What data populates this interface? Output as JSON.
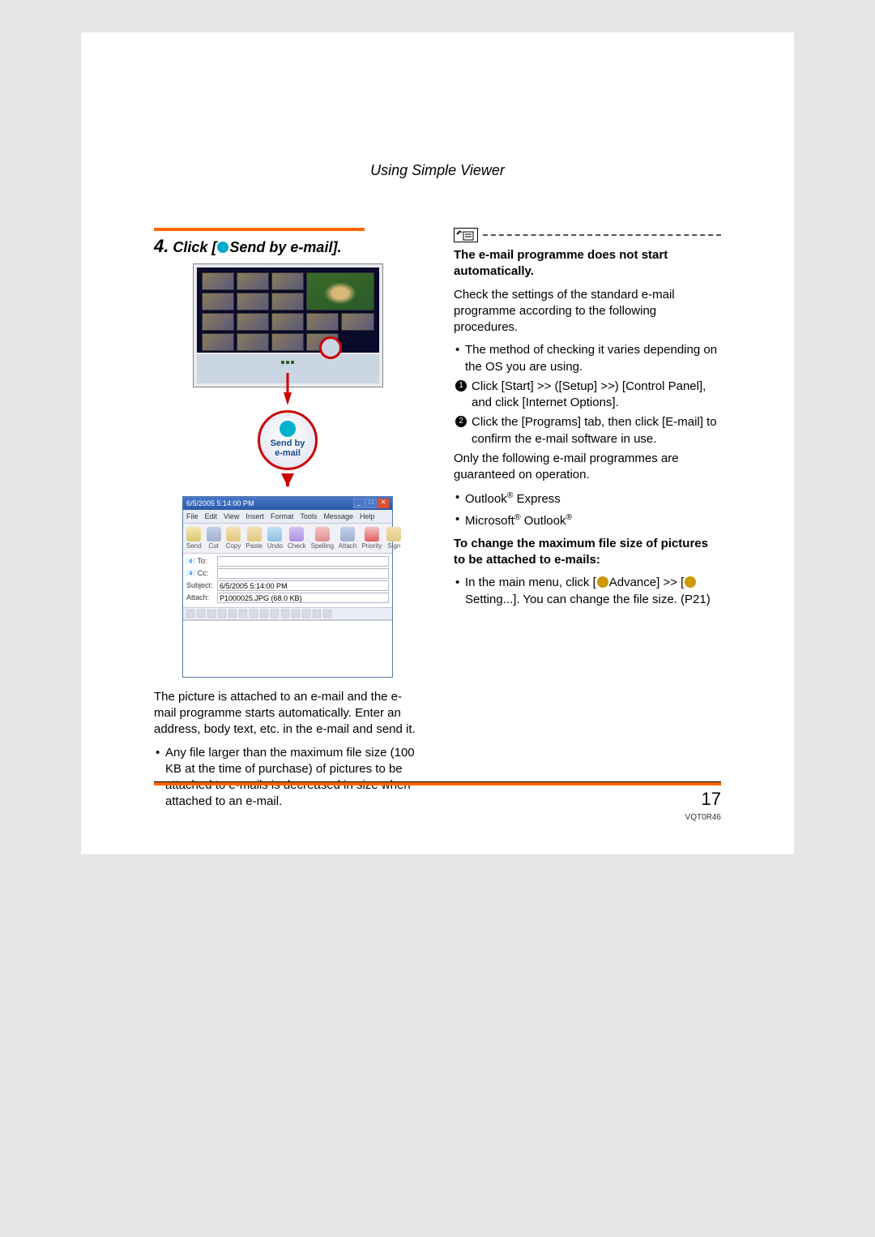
{
  "header": "Using Simple Viewer",
  "left": {
    "step_number": "4.",
    "step_text_prefix": "Click [",
    "step_text_suffix": "Send by e-mail].",
    "big_button": "Send by\ne-mail",
    "email_window": {
      "title": "6/5/2005 5:14:00 PM",
      "menus": [
        "File",
        "Edit",
        "View",
        "Insert",
        "Format",
        "Tools",
        "Message",
        "Help"
      ],
      "toolbar": [
        "Send",
        "Cut",
        "Copy",
        "Paste",
        "Undo",
        "Check",
        "Spelling",
        "Attach",
        "Priority",
        "Sign"
      ],
      "to_label": "To:",
      "cc_label": "Cc:",
      "subject_label": "Subject:",
      "subject_value": "6/5/2005 5:14:00 PM",
      "attach_label": "Attach:",
      "attach_value": "P1000025.JPG (68.0 KB)"
    },
    "para1": "The picture is attached to an e-mail and the e-mail programme starts automatically. Enter an address, body text, etc. in the e-mail and send it.",
    "bullet1": "Any file larger than the maximum file size (100 KB at the time of purchase) of pictures to be attached to e-mails is decreased in size when attached to an e-mail."
  },
  "right": {
    "heading1": "The e-mail programme does not start automatically.",
    "para1": "Check the settings of the standard e-mail programme according to the following procedures.",
    "bullet1": "The method of checking it varies depending on the OS you are using.",
    "num1": "Click [Start] >> ([Setup] >>) [Control Panel], and click [Internet Options].",
    "num2": "Click the [Programs] tab, then click [E-mail] to confirm the e-mail software in use.",
    "para2": "Only the following e-mail programmes are guaranteed on operation.",
    "bullet2a": "Outlook",
    "bullet2a_suffix": " Express",
    "bullet2b_pre": "Microsoft",
    "bullet2b_post": " Outlook",
    "heading2": "To change the maximum file size of pictures to be attached to e-mails:",
    "bullet3_pre": "In the main menu, click [",
    "bullet3_mid": "Advance] >> [",
    "bullet3_post": "Setting...]. You can change the file size. (P21)"
  },
  "footer": {
    "page": "17",
    "code": "VQT0R46"
  }
}
